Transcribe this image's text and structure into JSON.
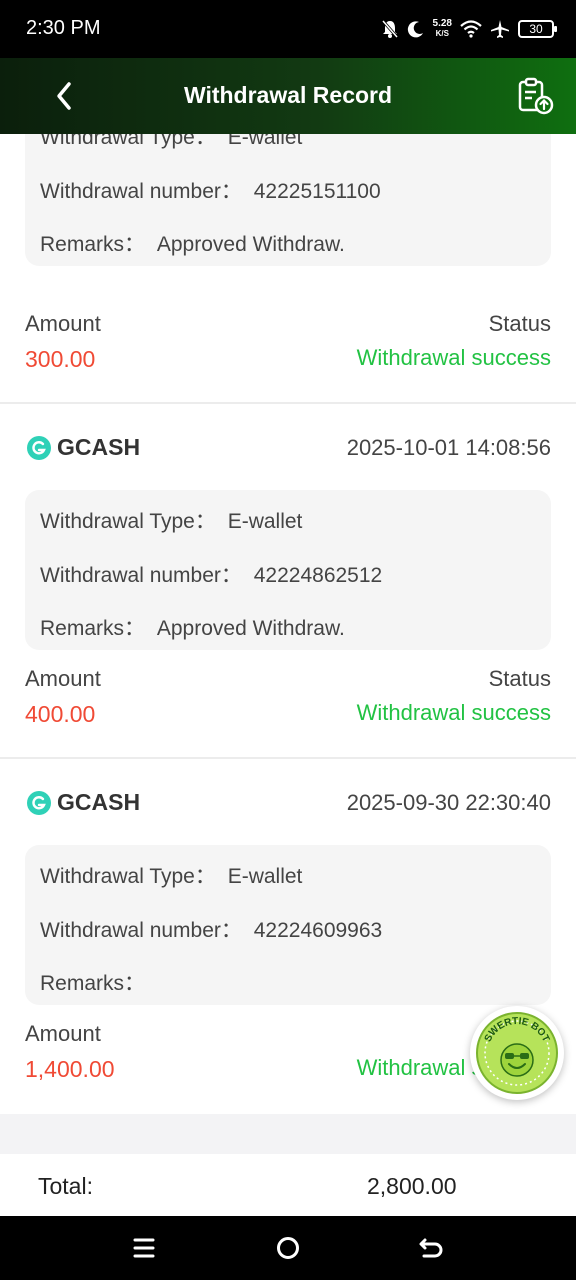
{
  "status_bar": {
    "time": "2:30 PM",
    "net_speed_value": "5.28",
    "net_speed_unit": "K/S",
    "battery": "30"
  },
  "header": {
    "title": "Withdrawal Record"
  },
  "labels": {
    "withdrawal_type": "Withdrawal Type：",
    "withdrawal_number": "Withdrawal number：",
    "remarks": "Remarks：",
    "amount": "Amount",
    "status": "Status"
  },
  "records": [
    {
      "withdrawal_type": "E-wallet",
      "withdrawal_number": "42225151100",
      "remarks": "Approved Withdraw.",
      "amount": "300.00",
      "status": "Withdrawal success"
    },
    {
      "provider": "GCASH",
      "datetime": "2025-10-01 14:08:56",
      "withdrawal_type": "E-wallet",
      "withdrawal_number": "42224862512",
      "remarks": "Approved Withdraw.",
      "amount": "400.00",
      "status": "Withdrawal success"
    },
    {
      "provider": "GCASH",
      "datetime": "2025-09-30 22:30:40",
      "withdrawal_type": "E-wallet",
      "withdrawal_number": "42224609963",
      "remarks": "",
      "amount": "1,400.00",
      "status": "Withdrawal success"
    }
  ],
  "total": {
    "label": "Total:",
    "value": "2,800.00"
  },
  "floating_badge": {
    "text": "SWERTIE BOT"
  },
  "colors": {
    "amount": "#f04a35",
    "status_success": "#22c243",
    "header_gradient_end": "#0f6f10",
    "gcash_logo": "#2fd1b7"
  },
  "icons": {
    "back": "chevron-left-icon",
    "record": "clipboard-upload-icon",
    "nav_menu": "menu-icon",
    "nav_home": "home-circle-icon",
    "nav_back": "back-arrow-icon"
  }
}
